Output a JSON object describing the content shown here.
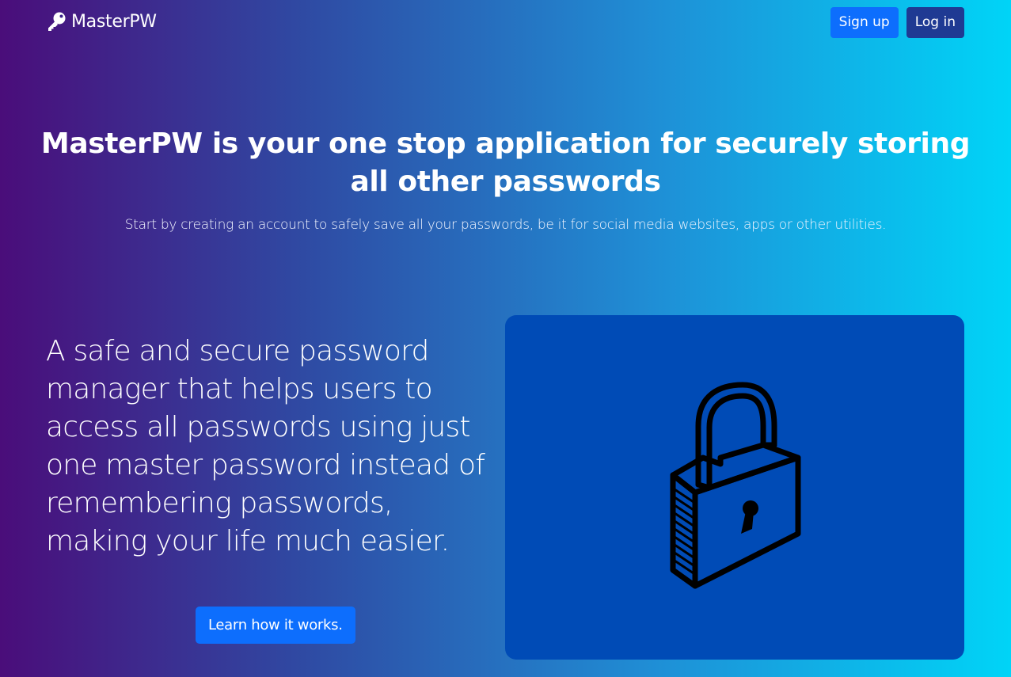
{
  "navbar": {
    "brand_text": "MasterPW",
    "brand_icon": "key-icon",
    "signup_label": "Sign up",
    "login_label": "Log in"
  },
  "hero": {
    "title": "MasterPW is your one stop application for securely storing all other passwords",
    "subtitle": "Start by creating an account to safely save all your passwords, be it for social media websites, apps or other utilities."
  },
  "feature": {
    "description": "A safe and secure password manager that helps users to access all passwords using just one master password instead of remembering passwords, making your life much easier.",
    "learn_label": "Learn how it works.",
    "image_icon": "padlock-icon"
  },
  "colors": {
    "gradient_start": "#4a0d7a",
    "gradient_end": "#00d4f7",
    "primary_button": "#0d6efd",
    "login_button": "#1f3a93",
    "lock_panel": "#004bb6"
  }
}
